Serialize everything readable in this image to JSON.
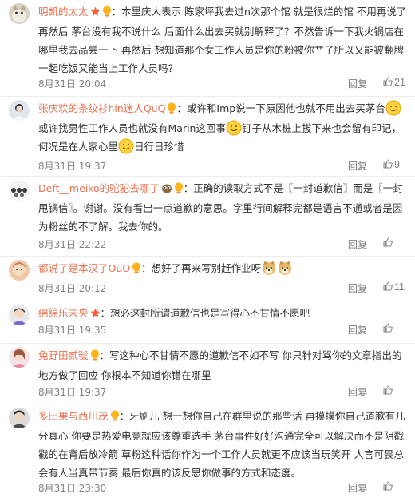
{
  "comments": [
    {
      "user": "明凯的太太",
      "text_parts": [
        "：本里庆人表示 陈家坪我去过n次那个馆 就是很烂的馆 不用再说了 再然后 茅台没有我不说什么 后面什么出去买就别解释了？不然告诉一下我火锅店在哪里我去品尝一下 再然后 想知道那个女工作人员是你的粉被你艹了所以又能被翻牌一起吃饭又能当上工作人员吗？"
      ],
      "date": "8月31日 20:04",
      "reply": "回复",
      "likes": "21"
    },
    {
      "user": "张庆欢的条纹衫hin迷人QuQ",
      "text_parts": [
        "：或许和Imp说一下原因他也就不用出去买茅台",
        "或许找男性工作人员也就没有Marin这回事",
        "钉子从木桩上拔下来也会留有印记，何况是在人家心里",
        "日行日珍惜"
      ],
      "date": "8月31日 19:37",
      "reply": "回复",
      "likes": "9"
    },
    {
      "user": "Deft__meiko的驼驼去哪了",
      "text_parts": [
        "：正确的读取方式不是〖一封道歉信〗而是〖一封甩锅信〗。谢谢。没有看出一点道歉的意思。字里行间解释完都是语言不通或者是因为粉丝的不了解。我去你的。"
      ],
      "date": "8月31日 22:22",
      "reply": "回复",
      "likes": ""
    },
    {
      "user": "都说了是本汉了OuO",
      "text_parts": [
        "：想好了再来写别赶作业呀"
      ],
      "date": "8月31日 20:12",
      "reply": "回复",
      "likes": "11"
    },
    {
      "user": "绵绵乐未央",
      "text_parts": [
        "：想必这封所谓道歉信也是写得心不甘情不愿吧"
      ],
      "date": "8月31日 19:35",
      "reply": "回复",
      "likes": ""
    },
    {
      "user": "兔野田贰號",
      "text_parts": [
        "：写这种心不甘情不愿的道歉信不如不写 你只针对骂你的文章指出的地方做了回应 你根本不知道你错在哪里"
      ],
      "date": "8月31日 19:37",
      "reply": "回复",
      "likes": ""
    },
    {
      "user": "多田果与西川茂",
      "text_parts": [
        "：牙刷儿  想一想你自己在群里说的那些话  再摸摸你自己道歉有几分真心 你要是热爱电竞就应该尊重选手  茅台事件好好沟通完全可以解决而不是阴戳戳的在背后放冷箭  草粉这种话你作为一个工作人员就更不应该当玩笑开  人言可畏总会有人当真带节奏  最后你真的该反思你做事的方式和态度。"
      ],
      "date": "8月31日 23:30",
      "reply": "回复",
      "likes": ""
    }
  ],
  "colors": {
    "username": "#eb7350",
    "text": "#333333",
    "meta": "#808080",
    "divider": "#ededed"
  },
  "icons": {
    "like": "thumbs-up-icon",
    "badge": "weibo-lightbulb-badge-icon",
    "emoji": "smile-emoji-icon"
  }
}
